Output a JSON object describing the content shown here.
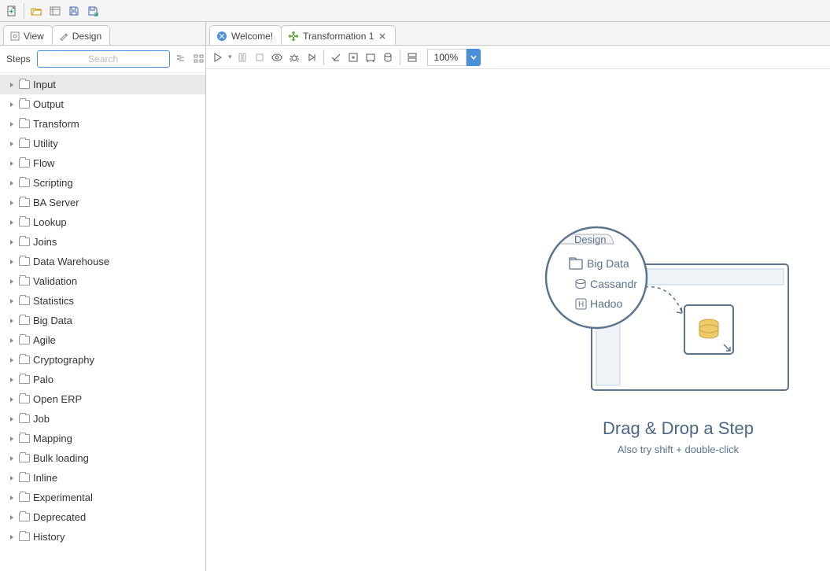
{
  "top_toolbar": {
    "new": "new",
    "open": "open",
    "explore": "explore",
    "save": "save",
    "save_as": "save-as"
  },
  "side_tabs": {
    "view": {
      "label": "View"
    },
    "design": {
      "label": "Design"
    }
  },
  "search": {
    "label": "Steps",
    "placeholder": "Search"
  },
  "categories": [
    {
      "label": "Input",
      "selected": true
    },
    {
      "label": "Output"
    },
    {
      "label": "Transform"
    },
    {
      "label": "Utility"
    },
    {
      "label": "Flow"
    },
    {
      "label": "Scripting"
    },
    {
      "label": "BA Server"
    },
    {
      "label": "Lookup"
    },
    {
      "label": "Joins"
    },
    {
      "label": "Data Warehouse"
    },
    {
      "label": "Validation"
    },
    {
      "label": "Statistics"
    },
    {
      "label": "Big Data"
    },
    {
      "label": "Agile"
    },
    {
      "label": "Cryptography"
    },
    {
      "label": "Palo"
    },
    {
      "label": "Open ERP"
    },
    {
      "label": "Job"
    },
    {
      "label": "Mapping"
    },
    {
      "label": "Bulk loading"
    },
    {
      "label": "Inline"
    },
    {
      "label": "Experimental"
    },
    {
      "label": "Deprecated"
    },
    {
      "label": "History"
    }
  ],
  "editor_tabs": {
    "welcome": {
      "label": "Welcome!"
    },
    "transform": {
      "label": "Transformation 1"
    }
  },
  "canvas_toolbar": {
    "zoom_value": "100%"
  },
  "illustration": {
    "design_tab": "Design",
    "big_data": "Big Data",
    "cassandra": "Cassandr",
    "hadoop": "Hadoo",
    "title": "Drag & Drop a Step",
    "subtitle": "Also try shift + double-click"
  }
}
